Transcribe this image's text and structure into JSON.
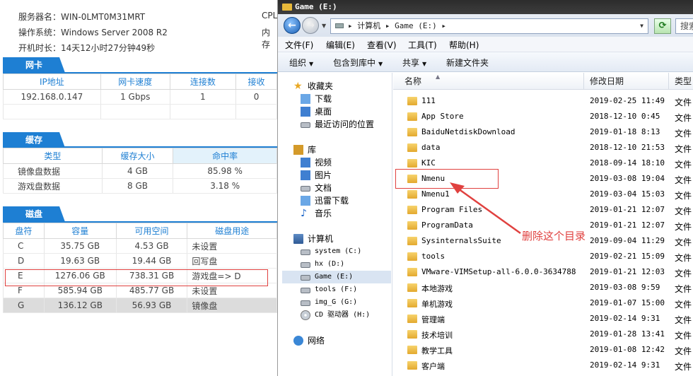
{
  "server": {
    "name_label": "服务器名：",
    "name": "WIN-0LMT0M31MRT",
    "os_label": "操作系统：",
    "os": "Windows Server 2008 R2",
    "uptime_label": "开机时长：",
    "uptime": "14天12小时27分钟49秒",
    "cpu_label": "CPL",
    "mem_label": "内存"
  },
  "nic": {
    "title": "网卡",
    "headers": [
      "IP地址",
      "网卡速度",
      "连接数",
      "接收"
    ],
    "rows": [
      [
        "192.168.0.147",
        "1 Gbps",
        "1",
        "0"
      ]
    ]
  },
  "cache": {
    "title": "缓存",
    "headers": [
      "类型",
      "缓存大小",
      "命中率"
    ],
    "rows": [
      [
        "镜像盘数据",
        "4 GB",
        "85.98 %"
      ],
      [
        "游戏盘数据",
        "8 GB",
        "3.18 %"
      ]
    ]
  },
  "disk": {
    "title": "磁盘",
    "headers": [
      "盘符",
      "容量",
      "可用空间",
      "磁盘用途"
    ],
    "rows": [
      [
        "C",
        "35.75 GB",
        "4.53 GB",
        "未设置"
      ],
      [
        "D",
        "19.63 GB",
        "19.44 GB",
        "回写盘"
      ],
      [
        "E",
        "1276.06 GB",
        "738.31 GB",
        "游戏盘=> D"
      ],
      [
        "F",
        "585.94 GB",
        "485.77 GB",
        "未设置"
      ],
      [
        "G",
        "136.12 GB",
        "56.93 GB",
        "镜像盘"
      ]
    ]
  },
  "explorer": {
    "title": "Game (E:)",
    "address": "▸ 计算机 ▸ Game (E:) ▸",
    "search_placeholder": "搜索",
    "menu": [
      "文件(F)",
      "编辑(E)",
      "查看(V)",
      "工具(T)",
      "帮助(H)"
    ],
    "commands": [
      "组织",
      "包含到库中",
      "共享",
      "新建文件夹"
    ],
    "nav": {
      "favorites": "收藏夹",
      "downloads": "下载",
      "desktop": "桌面",
      "recent": "最近访问的位置",
      "libraries": "库",
      "videos": "视频",
      "pictures": "图片",
      "documents": "文档",
      "thunder": "迅雷下载",
      "music": "音乐",
      "computer": "计算机",
      "drives": [
        "system (C:)",
        "hx (D:)",
        "Game (E:)",
        "tools (F:)",
        "img_G (G:)",
        "CD 驱动器 (H:)"
      ],
      "network": "网络"
    },
    "columns": [
      "名称",
      "修改日期",
      "类型"
    ],
    "files": [
      {
        "name": "111",
        "date": "2019-02-25 11:49",
        "type": "文件"
      },
      {
        "name": "App Store",
        "date": "2018-12-10 0:45",
        "type": "文件"
      },
      {
        "name": "BaiduNetdiskDownload",
        "date": "2019-01-18 8:13",
        "type": "文件"
      },
      {
        "name": "data",
        "date": "2018-12-10 21:53",
        "type": "文件"
      },
      {
        "name": "KIC",
        "date": "2018-09-14 18:10",
        "type": "文件"
      },
      {
        "name": "Nmenu",
        "date": "2019-03-08 19:04",
        "type": "文件"
      },
      {
        "name": "Nmenu1",
        "date": "2019-03-04 15:03",
        "type": "文件"
      },
      {
        "name": "Program Files",
        "date": "2019-01-21 12:07",
        "type": "文件"
      },
      {
        "name": "ProgramData",
        "date": "2019-01-21 12:07",
        "type": "文件"
      },
      {
        "name": "SysinternalsSuite",
        "date": "2019-09-04 11:29",
        "type": "文件"
      },
      {
        "name": "tools",
        "date": "2019-02-21 15:09",
        "type": "文件"
      },
      {
        "name": "VMware-VIMSetup-all-6.0.0-3634788",
        "date": "2019-01-21 12:03",
        "type": "文件"
      },
      {
        "name": "本地游戏",
        "date": "2019-03-08 9:59",
        "type": "文件"
      },
      {
        "name": "单机游戏",
        "date": "2019-01-07 15:00",
        "type": "文件"
      },
      {
        "name": "管理端",
        "date": "2019-02-14 9:31",
        "type": "文件"
      },
      {
        "name": "技术培训",
        "date": "2019-01-28 13:41",
        "type": "文件"
      },
      {
        "name": "教学工具",
        "date": "2019-01-08 12:42",
        "type": "文件"
      },
      {
        "name": "客户端",
        "date": "2019-02-14 9:31",
        "type": "文件"
      }
    ]
  },
  "annotation": {
    "text": "删除这个目录",
    "color": "#e0413f"
  },
  "colors": {
    "accent": "#1e7fd3",
    "highlight_box": "#e0413f",
    "folder": "#f0c24b"
  }
}
